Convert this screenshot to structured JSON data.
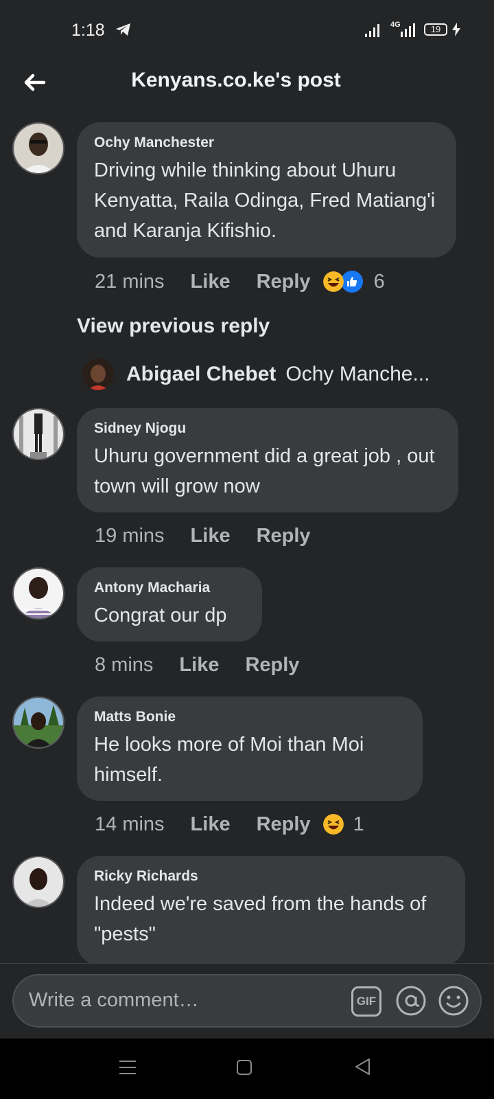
{
  "status_bar": {
    "time": "1:18",
    "network": "4G",
    "battery": "19"
  },
  "header": {
    "title": "Kenyans.co.ke's post"
  },
  "comments": [
    {
      "author": "Ochy Manchester",
      "text": "Driving while thinking about Uhuru Kenyatta, Raila Odinga, Fred Matiang'i and Karanja Kifishio.",
      "time": "21 mins",
      "like": "Like",
      "reply": "Reply",
      "reaction_count": "6"
    },
    {
      "author": "Sidney Njogu",
      "text": "Uhuru government did a great job , out town will grow now",
      "time": "19 mins",
      "like": "Like",
      "reply": "Reply"
    },
    {
      "author": "Antony Macharia",
      "text": "Congrat our dp",
      "time": "8 mins",
      "like": "Like",
      "reply": "Reply"
    },
    {
      "author": "Matts Bonie",
      "text": "He looks more of Moi than Moi himself.",
      "time": "14 mins",
      "like": "Like",
      "reply": "Reply",
      "reaction_count": "1"
    },
    {
      "author": "Ricky Richards",
      "text": "Indeed we're saved from the hands of \"pests\""
    }
  ],
  "view_previous_reply": "View previous reply",
  "nested_reply": {
    "author": "Abigael Chebet",
    "preview": "Ochy Manche..."
  },
  "composer": {
    "placeholder": "Write a comment…",
    "gif_label": "GIF"
  },
  "icons": {
    "back": "arrow-left-icon",
    "telegram": "telegram-icon",
    "signal": "signal-icon",
    "battery": "battery-icon",
    "charging": "bolt-icon",
    "haha": "haha-reaction-icon",
    "like": "like-reaction-icon",
    "at": "at-icon",
    "emoji": "smiley-icon",
    "nav_menu": "menu-icon",
    "nav_home": "home-square-icon",
    "nav_back": "triangle-back-icon"
  },
  "colors": {
    "background": "#242526",
    "bubble": "#3a3b3c",
    "text": "#e4e6eb",
    "secondary_text": "#b0b3b8",
    "like_blue": "#1877f2",
    "haha_yellow": "#f7b928"
  }
}
